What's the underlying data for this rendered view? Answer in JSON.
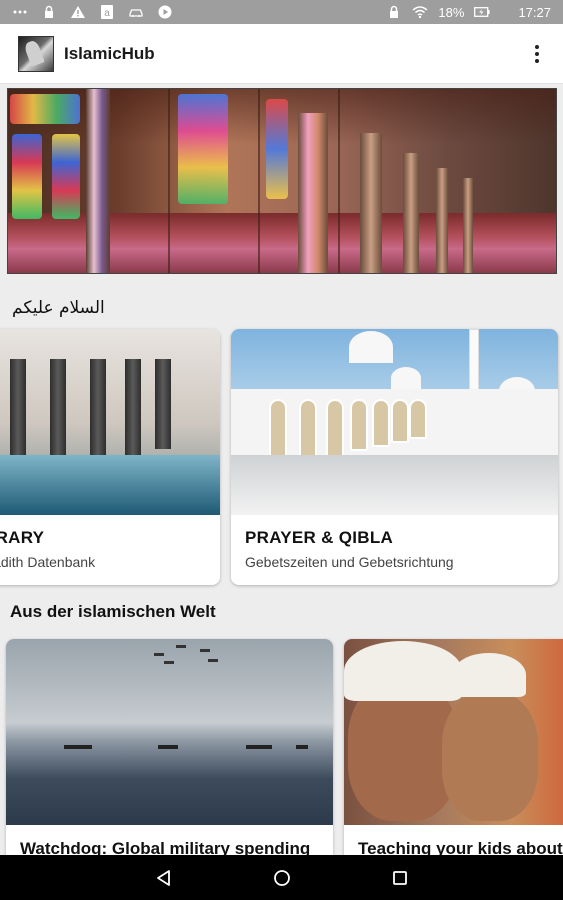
{
  "status_bar": {
    "time": "17:27",
    "battery": "18%",
    "icons": [
      "more-dots-icon",
      "lock-icon",
      "warning-icon",
      "amazon-icon",
      "car-icon",
      "play-icon",
      "lock-icon",
      "wifi-icon",
      "battery-icon"
    ]
  },
  "app_bar": {
    "title": "IslamicHub",
    "menu_icon": "overflow-menu-icon"
  },
  "greeting": "السلام عليكم",
  "feature_cards": [
    {
      "title": "LIBRARY",
      "visible_title": "BRARY",
      "subtitle": "Hadith Datenbank",
      "visible_subtitle": "Hadith Datenbank"
    },
    {
      "title": "PRAYER & QIBLA",
      "subtitle": "Gebetszeiten und Gebetsrichtung"
    }
  ],
  "section_title": "Aus der islamischen Welt",
  "news": [
    {
      "title": "Watchdog: Global military spending"
    },
    {
      "title": "Teaching your kids about Ra"
    }
  ],
  "nav_bar": {
    "back_icon": "back-icon",
    "home_icon": "home-icon",
    "recents_icon": "recents-icon"
  },
  "colors": {
    "status_bar_bg": "#9e9e9e",
    "app_bar_bg": "#ffffff",
    "page_bg": "#ededed",
    "nav_bar_bg": "#000000"
  }
}
